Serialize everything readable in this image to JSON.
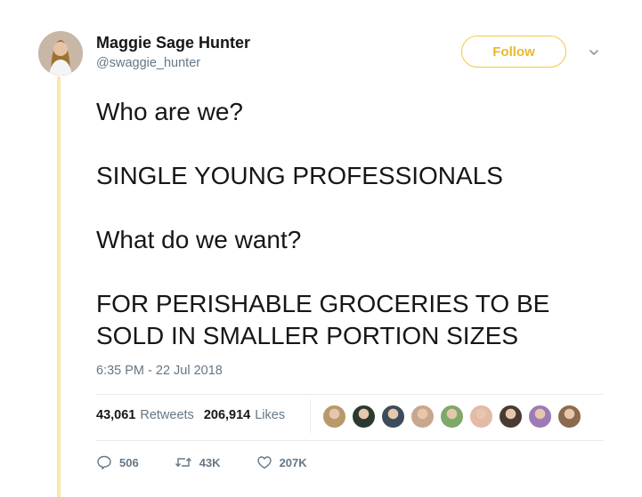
{
  "author": {
    "name": "Maggie Sage Hunter",
    "handle": "@swaggie_hunter"
  },
  "follow_button": {
    "label": "Follow"
  },
  "tweet": {
    "lines": [
      "Who are we?",
      "SINGLE YOUNG PROFESSIONALS",
      "What do we want?",
      "FOR PERISHABLE GROCERIES TO BE",
      "SOLD IN SMALLER PORTION SIZES"
    ],
    "timestamp": "6:35 PM - 22 Jul 2018"
  },
  "stats": {
    "retweets_count": "43,061",
    "retweets_label": "Retweets",
    "likes_count": "206,914",
    "likes_label": "Likes"
  },
  "likers": [
    {
      "color": "#b9986a"
    },
    {
      "color": "#2b3a2f"
    },
    {
      "color": "#3c4c5a"
    },
    {
      "color": "#c9a78d"
    },
    {
      "color": "#7fa86b"
    },
    {
      "color": "#e3b9a7"
    },
    {
      "color": "#4a3a34"
    },
    {
      "color": "#9e7bb4"
    },
    {
      "color": "#8c6a4f"
    }
  ],
  "actions": {
    "replies": "506",
    "retweets": "43K",
    "likes": "207K"
  },
  "colors": {
    "accent": "#e9b92a",
    "thread_line": "#fbe8a6",
    "muted": "#657786"
  }
}
